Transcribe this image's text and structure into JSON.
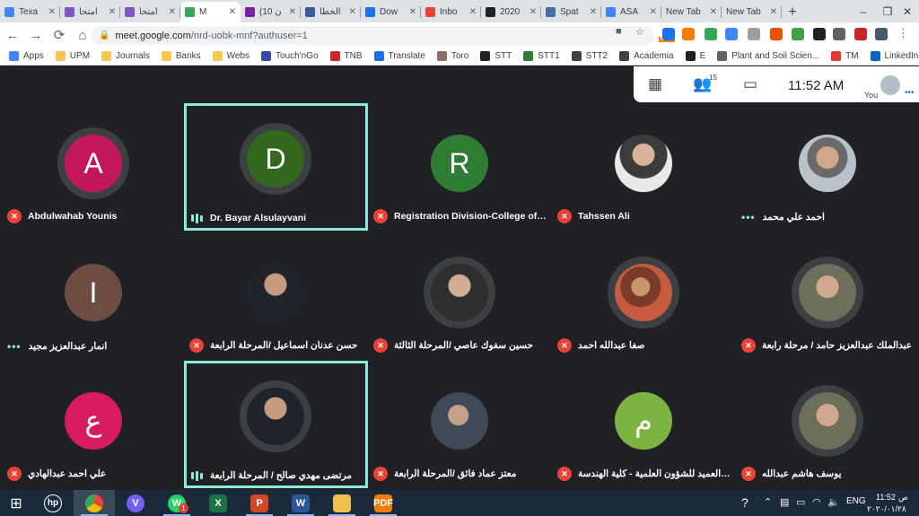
{
  "browser": {
    "tabs": [
      {
        "label": "Texa",
        "color": "#4285f4"
      },
      {
        "label": "امتحا",
        "color": "#7e57c2"
      },
      {
        "label": "امتحا",
        "color": "#7e57c2"
      },
      {
        "label": "M",
        "color": "#34a853",
        "active": true
      },
      {
        "label": "(10 ن",
        "color": "#7b1fa2"
      },
      {
        "label": "الخطا",
        "color": "#3b5998"
      },
      {
        "label": "Dow",
        "color": "#1a73e8"
      },
      {
        "label": "Inbo",
        "color": "#ea4335"
      },
      {
        "label": "2020",
        "color": "#202124"
      },
      {
        "label": "Spat",
        "color": "#4a6fa5"
      },
      {
        "label": "ASA",
        "color": "#4285f4"
      },
      {
        "label": "New Tab",
        "color": ""
      },
      {
        "label": "New Tab",
        "color": ""
      }
    ],
    "new_tab_symbol": "+",
    "url_host": "meet.google.com",
    "url_path": "/nrd-uobk-mnf?authuser=1",
    "bookmarks": [
      "Apps",
      "UPM",
      "Journals",
      "Banks",
      "Webs",
      "Touch'nGo",
      "TNB",
      "Translate",
      "Toro",
      "STT",
      "STT1",
      "STT2",
      "Academia",
      "E",
      "Plant and Soil Scien...",
      "TM",
      "LinkedIn"
    ],
    "new_badge": "NEW"
  },
  "meet": {
    "participant_count": "15",
    "time": "11:52 AM",
    "you_label": "You",
    "participants": [
      {
        "name": "Abdulwahab Younis",
        "initial": "A",
        "color": "#c2185b",
        "status": "muted",
        "ring": true
      },
      {
        "name": "Dr. Bayar Alsulayvani",
        "initial": "D",
        "color": "#33691e",
        "status": "speaking",
        "ring": true,
        "highlight": true
      },
      {
        "name": "Registration Division-College of En...",
        "initial": "R",
        "color": "#2e7d32",
        "status": "muted"
      },
      {
        "name": "Tahssen Ali",
        "photo": "p1",
        "status": "muted"
      },
      {
        "name": "احمد علي محمد",
        "photo": "p5",
        "status": "dots"
      },
      {
        "name": "انمار عبدالعزيز مجيد",
        "initial": "I",
        "color": "#6d4c41",
        "status": "dots"
      },
      {
        "name": "حسن عدنان اسماعيل /المرحلة الرابعة",
        "photo": "p2",
        "status": "muted"
      },
      {
        "name": "حسين سفوك عاصي /المرحلة الثالثة",
        "photo": "p4",
        "status": "muted",
        "ring": true
      },
      {
        "name": "صفا عبدالله احمد",
        "photo": "p3",
        "status": "muted",
        "ring": true
      },
      {
        "name": "عبدالملك عبدالعزيز حامد / مرحلة رابعة",
        "photo": "p7",
        "status": "muted",
        "ring": true
      },
      {
        "name": "علي احمد عبدالهادي",
        "initial": "ع",
        "color": "#d81b60",
        "status": "muted"
      },
      {
        "name": "مرتضى مهدي صالح / المرحلة الرابعة",
        "photo": "p2",
        "status": "speaking",
        "ring": true,
        "highlight": true
      },
      {
        "name": "معتز عماد فائق /المرحلة الرابعة",
        "photo": "p6",
        "status": "muted"
      },
      {
        "name": "مكتب معاون العميد للشؤون العلمية - كلية الهندسة",
        "initial": "م",
        "color": "#7cb342",
        "status": "muted"
      },
      {
        "name": "يوسف هاشم عبدالله",
        "photo": "p7",
        "status": "muted",
        "ring": true
      }
    ]
  },
  "taskbar": {
    "apps": [
      {
        "name": "hp",
        "label": "hp",
        "color": ""
      },
      {
        "name": "chrome",
        "label": "",
        "color": "#34a853",
        "open": true,
        "selected": true
      },
      {
        "name": "viber",
        "label": "V",
        "color": "#7360f2"
      },
      {
        "name": "whatsapp",
        "label": "W",
        "color": "#25d366",
        "open": true,
        "badge": "1"
      },
      {
        "name": "excel",
        "label": "X",
        "color": "#1e7145"
      },
      {
        "name": "powerpoint",
        "label": "P",
        "color": "#d24726",
        "open": true
      },
      {
        "name": "word",
        "label": "W",
        "color": "#2b579a",
        "open": true
      },
      {
        "name": "explorer",
        "label": "",
        "color": "#f0c04a",
        "open": true
      },
      {
        "name": "pdf",
        "label": "PDF",
        "color": "#f57c00",
        "open": true
      }
    ],
    "lang": "ENG",
    "time": "11:52",
    "ampm": "ص",
    "date": "٢٠٢٠/٠١/٢٨"
  }
}
